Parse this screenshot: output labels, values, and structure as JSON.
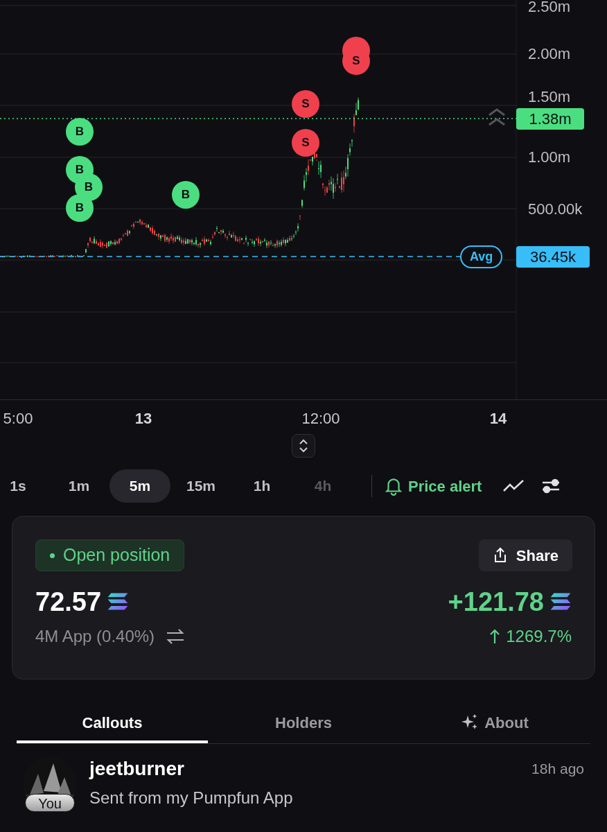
{
  "chart": {
    "y_axis": [
      "2.50m",
      "2.00m",
      "1.50m",
      "1.00m",
      "500.00k"
    ],
    "x_axis": [
      {
        "label": "5:00",
        "major": false
      },
      {
        "label": "13",
        "major": true
      },
      {
        "label": "12:00",
        "major": false
      },
      {
        "label": "14",
        "major": true
      }
    ],
    "markers": [
      {
        "kind": "sell"
      },
      {
        "kind": "sell",
        "label": "S"
      },
      {
        "kind": "sell",
        "label": "S"
      },
      {
        "kind": "buy",
        "label": "B"
      },
      {
        "kind": "sell",
        "label": "S"
      },
      {
        "kind": "buy",
        "label": "B"
      },
      {
        "kind": "buy",
        "label": "B"
      },
      {
        "kind": "buy",
        "label": "B"
      },
      {
        "kind": "buy",
        "label": "B"
      }
    ],
    "price_tag": "1.38m",
    "avg": {
      "label": "Avg",
      "value": "36.45k"
    }
  },
  "timeframes": [
    {
      "label": "1s",
      "selected": false,
      "disabled": false
    },
    {
      "label": "1m",
      "selected": false,
      "disabled": false
    },
    {
      "label": "5m",
      "selected": true,
      "disabled": false
    },
    {
      "label": "15m",
      "selected": false,
      "disabled": false
    },
    {
      "label": "1h",
      "selected": false,
      "disabled": false
    },
    {
      "label": "4h",
      "selected": false,
      "disabled": true
    }
  ],
  "price_alert": "Price alert",
  "position": {
    "status": "Open position",
    "share": "Share",
    "amount": "72.57",
    "pnl": "+121.78",
    "fee": "4M App (0.40%)",
    "change": "1269.7%"
  },
  "tabs": [
    {
      "label": "Callouts",
      "selected": true,
      "icon": false
    },
    {
      "label": "Holders",
      "selected": false,
      "icon": false
    },
    {
      "label": "About",
      "selected": false,
      "icon": true
    }
  ],
  "callouts": [
    {
      "user": "jeetburner",
      "badge": "You",
      "time": "18h ago",
      "text": "Sent from my Pumpfun App"
    }
  ]
}
